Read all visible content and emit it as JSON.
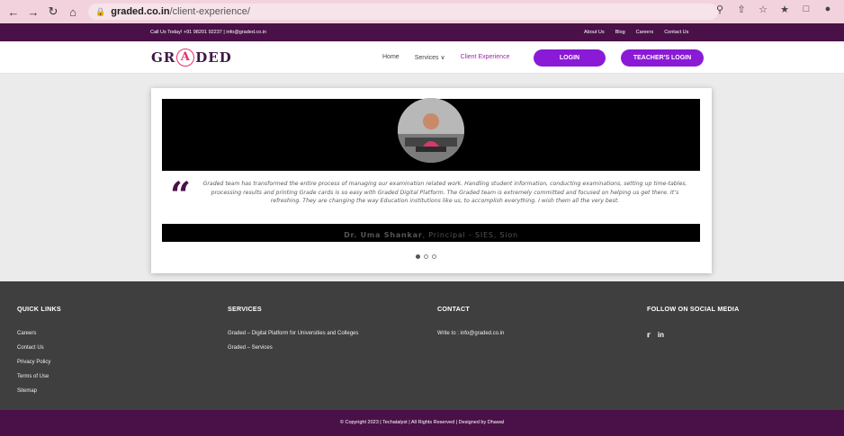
{
  "browser": {
    "url_host": "graded.co.in",
    "url_path": "/client-experience/"
  },
  "topbar": {
    "contact": "Call Us Today! +91 98201 92237 | info@graded.co.in",
    "links": [
      "About Us",
      "Blog",
      "Careers",
      "Contact Us"
    ]
  },
  "header": {
    "logo_left": "GR",
    "logo_a": "A",
    "logo_right": "DED",
    "nav": [
      {
        "label": "Home"
      },
      {
        "label": "Services ∨"
      },
      {
        "label": "Client Experience"
      }
    ],
    "login_label": "LOGIN",
    "teacher_login_label": "TEACHER'S LOGIN"
  },
  "testimonial": {
    "quote_mark": "“",
    "text": "Graded team has transformed the entire process of managing our examination related work. Handling student information, conducting examinations, setting up time-tables, processing results and printing Grade cards is so easy with Graded Digital Platform. The Graded team is extremely committed and focused on helping us get there. It’s refreshing. They are changing the way Education institutions like us, to accomplish everything. I wish them all the very best.",
    "author_name": "Dr. Uma Shankar",
    "author_role": ", Principal - SIES, Sion"
  },
  "footer": {
    "quick_links": {
      "title": "QUICK LINKS",
      "items": [
        "Careers",
        "Contact Us",
        "Privacy Policy",
        "Terms of Use",
        "Sitemap"
      ]
    },
    "services": {
      "title": "SERVICES",
      "items": [
        "Graded – Digital Platform for Universities and Colleges",
        "Graded – Services"
      ]
    },
    "contact": {
      "title": "CONTACT",
      "items": [
        "Write to : info@graded.co.in"
      ]
    },
    "social": {
      "title": "FOLLOW ON SOCIAL MEDIA",
      "icons": [
        "twitter-icon",
        "linkedin-icon"
      ]
    },
    "copyright": "© Copyright 2023 | Techatalyst | All Rights Reserved | Designed by Dhawal"
  },
  "colors": {
    "brand_purple": "#4a1148",
    "button_purple": "#8a1ad6",
    "accent_pink": "#e4336b"
  }
}
